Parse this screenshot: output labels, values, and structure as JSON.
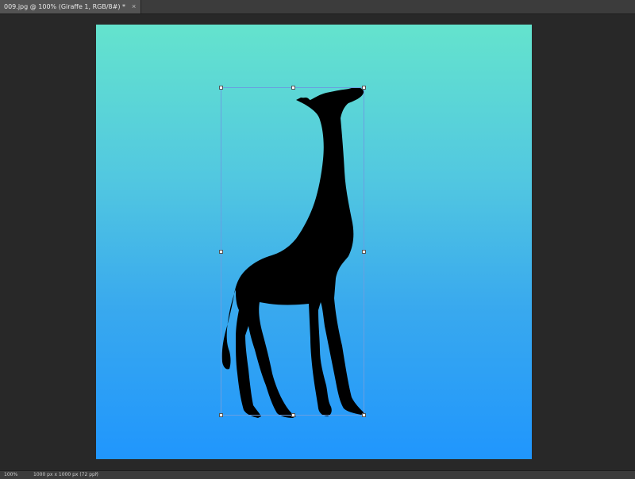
{
  "document_tab": {
    "title": "009.jpg @ 100% (Giraffe 1, RGB/8#) *",
    "close_glyph": "×"
  },
  "canvas": {
    "gradient_top": "#64e3cd",
    "gradient_bottom": "#2096fd",
    "layer_name": "Giraffe 1",
    "shape_color": "#000000"
  },
  "transform": {
    "border_color": "#6a9fe0"
  },
  "status_bar": {
    "zoom": "100%",
    "doc_info": "1000 px x 1000 px (72 ppi)",
    "arrow_glyph": "›"
  }
}
